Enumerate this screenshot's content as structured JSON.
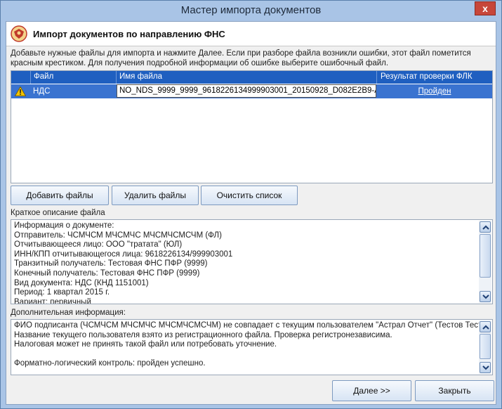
{
  "window": {
    "title": "Мастер импорта документов",
    "close_glyph": "x"
  },
  "header": {
    "title": "Импорт документов по направлению ФНС",
    "logo_icon": "fns-eagle-icon"
  },
  "description": "Добавьте нужные файлы для импорта и нажмите Далее. Если при разборе файла возникли ошибки, этот файл пометится красным крестиком. Для получения подробной информации об ошибке выберите ошибочный файл.",
  "file_grid": {
    "columns": [
      "Файл",
      "Имя файла",
      "Результат проверки ФЛК"
    ],
    "rows": [
      {
        "status_icon": "warning-icon",
        "type": "НДС",
        "filename": "NO_NDS_9999_9999_9618226134999903001_20150928_D082E2B9-A...",
        "result": "Пройден"
      }
    ]
  },
  "buttons": {
    "add": "Добавить файлы",
    "delete": "Удалить файлы",
    "clear": "Очистить список",
    "next": "Далее >>",
    "close": "Закрыть"
  },
  "short_description": {
    "label": "Краткое описание файла",
    "lines": [
      "Информация о документе:",
      "Отправитель: ЧСМЧСМ МЧСМЧС МЧСМЧСМСЧМ (ФЛ)",
      "Отчитывающееся лицо: ООО \"тратата\" (ЮЛ)",
      "ИНН/КПП отчитывающегося лица: 9618226134/999903001",
      "Транзитный получатель: Тестовая ФНС ПФР (9999)",
      "Конечный получатель: Тестовая ФНС ПФР (9999)",
      "Вид документа: НДС (КНД 1151001)",
      "Период: 1 квартал 2015 г.",
      "Вариант: первичный"
    ]
  },
  "additional_info": {
    "label": "Дополнительная информация:",
    "lines": [
      "ФИО подписанта (ЧСМЧСМ МЧСМЧС МЧСМЧСМСЧМ) не совпадает с текущим пользователем \"Астрал Отчет\" (Тестов Тест).",
      "Название текущего пользователя взято из регистрационного файла. Проверка регистронезависима.",
      "Налоговая может не принять такой файл или потребовать уточнение.",
      "",
      "Форматно-логический контроль: пройден успешно."
    ]
  },
  "colors": {
    "selection": "#3a73d0",
    "grid_header": "#1f5fc0",
    "window_frame": "#a9c4e6"
  }
}
